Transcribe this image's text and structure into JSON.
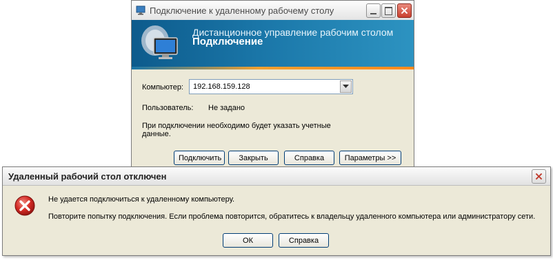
{
  "rdp_window": {
    "title": "Подключение к удаленному рабочему столу",
    "banner_line1": "Дистанционное управление рабочим столом",
    "banner_line2": "Подключение",
    "computer_label": "Компьютер:",
    "computer_value": "192.168.159.128",
    "user_label": "Пользователь:",
    "user_value": "Не задано",
    "note_line1": "При подключении необходимо будет указать учетные",
    "note_line2": "данные.",
    "buttons": {
      "connect": "Подключить",
      "close": "Закрыть",
      "help": "Справка",
      "options": "Параметры >>"
    }
  },
  "error_dialog": {
    "title": "Удаленный рабочий стол отключен",
    "message_line1": "Не удается подключиться к удаленному компьютеру.",
    "message_line2": "Повторите попытку подключения. Если проблема повторится, обратитесь к владельцу удаленного компьютера или администратору сети.",
    "buttons": {
      "ok": "ОК",
      "help": "Справка"
    }
  },
  "icons": {
    "titlebar": "rdp-app-icon",
    "banner": "remote-desktop-monitor-icon",
    "error": "error-x-icon",
    "combo": "chevron-down-icon",
    "minimize": "minimize-icon",
    "maximize": "maximize-icon",
    "close": "close-icon"
  },
  "colors": {
    "close_button": "#d8473a",
    "error_icon": "#d42a24",
    "banner_start": "#0d5b8c",
    "banner_accent": "#ff8a1c",
    "dialog_bg": "#ece9d8"
  }
}
